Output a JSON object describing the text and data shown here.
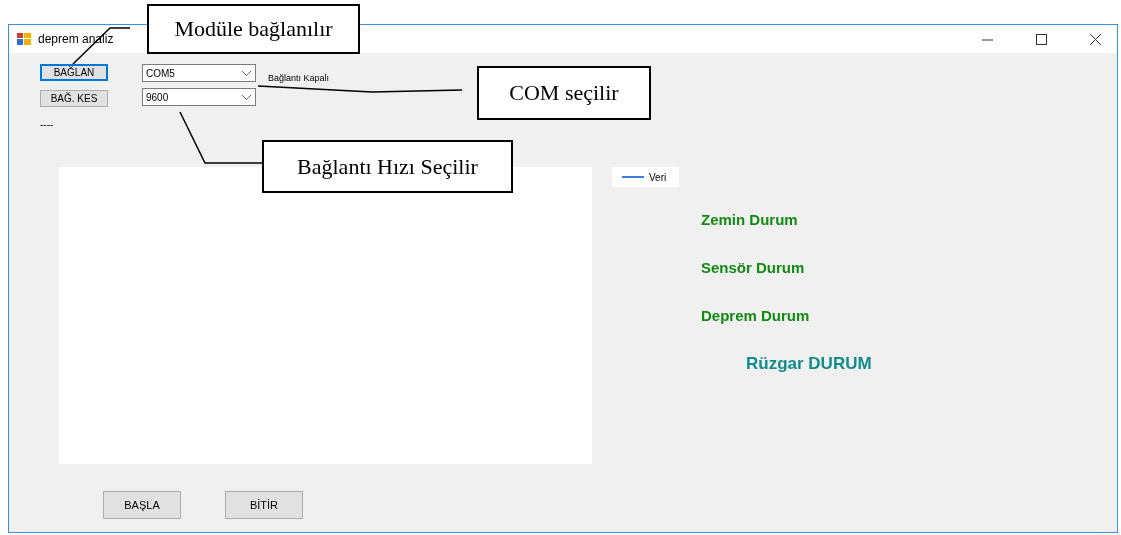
{
  "window": {
    "title": "deprem analiz"
  },
  "connection": {
    "connect_button": {
      "label": "BAĞLAN",
      "focused": true
    },
    "disconnect_button": {
      "label": "BAĞ. KES",
      "focused": false
    },
    "port_select": {
      "value": "COM5"
    },
    "baud_select": {
      "value": "9600"
    },
    "status": "Bağlantı Kapalı",
    "indicator": "----"
  },
  "chart": {
    "legend": "Veri"
  },
  "status_labels": [
    {
      "text": "Zemin Durum",
      "color": "#128a12"
    },
    {
      "text": "Sensör Durum",
      "color": "#128a12"
    },
    {
      "text": "Deprem Durum",
      "color": "#128a12"
    },
    {
      "text": "Rüzgar DURUM",
      "color": "#118b8b"
    }
  ],
  "buttons": [
    "BAŞLA",
    "BİTİR"
  ],
  "annotations": [
    "Modüle bağlanılır",
    "COM seçilir",
    "Bağlantı Hızı Seçilir"
  ]
}
